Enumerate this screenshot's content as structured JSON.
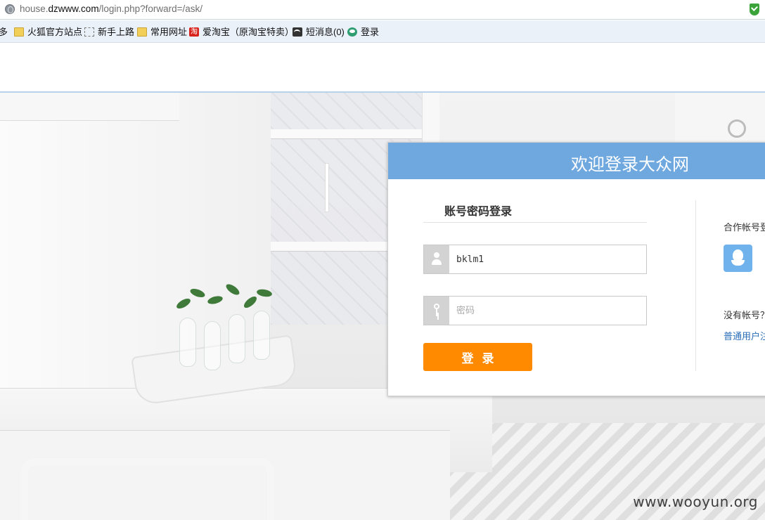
{
  "browser": {
    "url_prefix": "house.",
    "url_domain": "dzwww.com",
    "url_path": "/login.php?forward=/ask/"
  },
  "bookmarks": {
    "items": [
      {
        "label": "多",
        "icon": "none"
      },
      {
        "label": "火狐官方站点",
        "icon": "folder-icon"
      },
      {
        "label": "新手上路",
        "icon": "dashed-page-icon"
      },
      {
        "label": "常用网址",
        "icon": "folder-icon"
      },
      {
        "label": "爱淘宝（原淘宝特卖）",
        "icon": "taobao-icon",
        "icon_text": "淘"
      },
      {
        "label": "短消息(0)",
        "icon": "message-icon"
      },
      {
        "label": "登录",
        "icon": "login-icon"
      }
    ]
  },
  "login": {
    "title": "欢迎登录大众网",
    "tab_label": "账号密码登录",
    "username_value": "bklm1",
    "password_placeholder": "密码",
    "submit_label": "登录",
    "partner_label": "合作帐号登",
    "no_account_label": "没有帐号？",
    "register_link": "普通用户注"
  },
  "watermark": "www.wooyun.org",
  "colors": {
    "header_blue": "#6fa8df",
    "login_button": "#ff8a00",
    "qq_button": "#6fb2ec",
    "link": "#2a6db8"
  }
}
